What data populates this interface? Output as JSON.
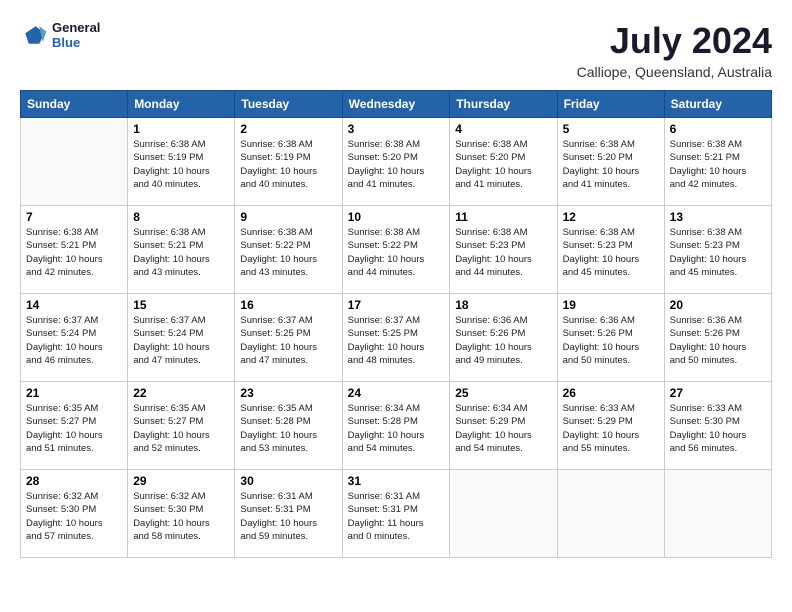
{
  "logo": {
    "text_general": "General",
    "text_blue": "Blue"
  },
  "title": "July 2024",
  "subtitle": "Calliope, Queensland, Australia",
  "header_days": [
    "Sunday",
    "Monday",
    "Tuesday",
    "Wednesday",
    "Thursday",
    "Friday",
    "Saturday"
  ],
  "weeks": [
    [
      {
        "day": "",
        "info": ""
      },
      {
        "day": "1",
        "info": "Sunrise: 6:38 AM\nSunset: 5:19 PM\nDaylight: 10 hours\nand 40 minutes."
      },
      {
        "day": "2",
        "info": "Sunrise: 6:38 AM\nSunset: 5:19 PM\nDaylight: 10 hours\nand 40 minutes."
      },
      {
        "day": "3",
        "info": "Sunrise: 6:38 AM\nSunset: 5:20 PM\nDaylight: 10 hours\nand 41 minutes."
      },
      {
        "day": "4",
        "info": "Sunrise: 6:38 AM\nSunset: 5:20 PM\nDaylight: 10 hours\nand 41 minutes."
      },
      {
        "day": "5",
        "info": "Sunrise: 6:38 AM\nSunset: 5:20 PM\nDaylight: 10 hours\nand 41 minutes."
      },
      {
        "day": "6",
        "info": "Sunrise: 6:38 AM\nSunset: 5:21 PM\nDaylight: 10 hours\nand 42 minutes."
      }
    ],
    [
      {
        "day": "7",
        "info": "Sunrise: 6:38 AM\nSunset: 5:21 PM\nDaylight: 10 hours\nand 42 minutes."
      },
      {
        "day": "8",
        "info": "Sunrise: 6:38 AM\nSunset: 5:21 PM\nDaylight: 10 hours\nand 43 minutes."
      },
      {
        "day": "9",
        "info": "Sunrise: 6:38 AM\nSunset: 5:22 PM\nDaylight: 10 hours\nand 43 minutes."
      },
      {
        "day": "10",
        "info": "Sunrise: 6:38 AM\nSunset: 5:22 PM\nDaylight: 10 hours\nand 44 minutes."
      },
      {
        "day": "11",
        "info": "Sunrise: 6:38 AM\nSunset: 5:23 PM\nDaylight: 10 hours\nand 44 minutes."
      },
      {
        "day": "12",
        "info": "Sunrise: 6:38 AM\nSunset: 5:23 PM\nDaylight: 10 hours\nand 45 minutes."
      },
      {
        "day": "13",
        "info": "Sunrise: 6:38 AM\nSunset: 5:23 PM\nDaylight: 10 hours\nand 45 minutes."
      }
    ],
    [
      {
        "day": "14",
        "info": "Sunrise: 6:37 AM\nSunset: 5:24 PM\nDaylight: 10 hours\nand 46 minutes."
      },
      {
        "day": "15",
        "info": "Sunrise: 6:37 AM\nSunset: 5:24 PM\nDaylight: 10 hours\nand 47 minutes."
      },
      {
        "day": "16",
        "info": "Sunrise: 6:37 AM\nSunset: 5:25 PM\nDaylight: 10 hours\nand 47 minutes."
      },
      {
        "day": "17",
        "info": "Sunrise: 6:37 AM\nSunset: 5:25 PM\nDaylight: 10 hours\nand 48 minutes."
      },
      {
        "day": "18",
        "info": "Sunrise: 6:36 AM\nSunset: 5:26 PM\nDaylight: 10 hours\nand 49 minutes."
      },
      {
        "day": "19",
        "info": "Sunrise: 6:36 AM\nSunset: 5:26 PM\nDaylight: 10 hours\nand 50 minutes."
      },
      {
        "day": "20",
        "info": "Sunrise: 6:36 AM\nSunset: 5:26 PM\nDaylight: 10 hours\nand 50 minutes."
      }
    ],
    [
      {
        "day": "21",
        "info": "Sunrise: 6:35 AM\nSunset: 5:27 PM\nDaylight: 10 hours\nand 51 minutes."
      },
      {
        "day": "22",
        "info": "Sunrise: 6:35 AM\nSunset: 5:27 PM\nDaylight: 10 hours\nand 52 minutes."
      },
      {
        "day": "23",
        "info": "Sunrise: 6:35 AM\nSunset: 5:28 PM\nDaylight: 10 hours\nand 53 minutes."
      },
      {
        "day": "24",
        "info": "Sunrise: 6:34 AM\nSunset: 5:28 PM\nDaylight: 10 hours\nand 54 minutes."
      },
      {
        "day": "25",
        "info": "Sunrise: 6:34 AM\nSunset: 5:29 PM\nDaylight: 10 hours\nand 54 minutes."
      },
      {
        "day": "26",
        "info": "Sunrise: 6:33 AM\nSunset: 5:29 PM\nDaylight: 10 hours\nand 55 minutes."
      },
      {
        "day": "27",
        "info": "Sunrise: 6:33 AM\nSunset: 5:30 PM\nDaylight: 10 hours\nand 56 minutes."
      }
    ],
    [
      {
        "day": "28",
        "info": "Sunrise: 6:32 AM\nSunset: 5:30 PM\nDaylight: 10 hours\nand 57 minutes."
      },
      {
        "day": "29",
        "info": "Sunrise: 6:32 AM\nSunset: 5:30 PM\nDaylight: 10 hours\nand 58 minutes."
      },
      {
        "day": "30",
        "info": "Sunrise: 6:31 AM\nSunset: 5:31 PM\nDaylight: 10 hours\nand 59 minutes."
      },
      {
        "day": "31",
        "info": "Sunrise: 6:31 AM\nSunset: 5:31 PM\nDaylight: 11 hours\nand 0 minutes."
      },
      {
        "day": "",
        "info": ""
      },
      {
        "day": "",
        "info": ""
      },
      {
        "day": "",
        "info": ""
      }
    ]
  ]
}
